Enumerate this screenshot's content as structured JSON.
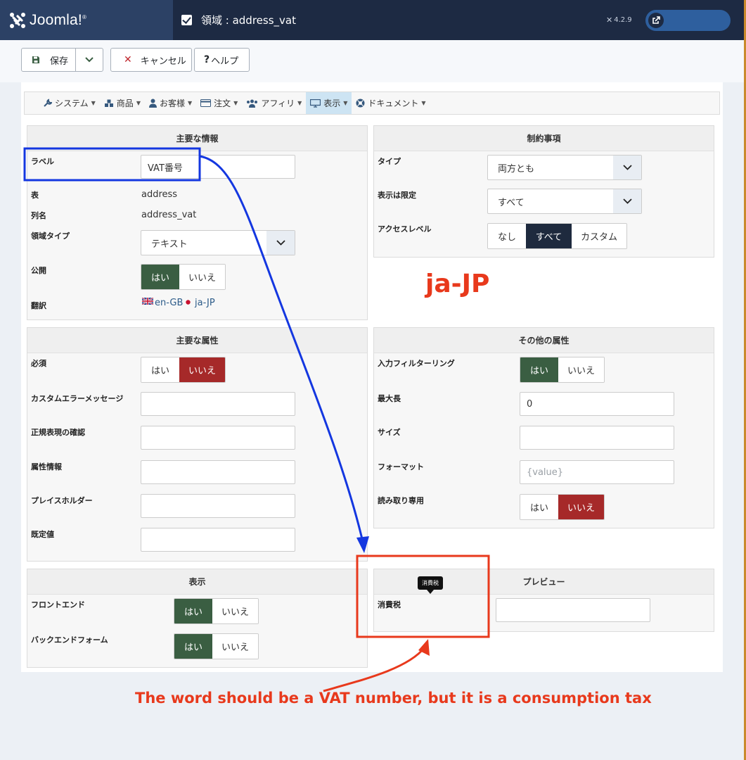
{
  "header": {
    "logo_text": "Joomla!",
    "title": "領域 : address_vat",
    "version": "4.2.9"
  },
  "toolbar": {
    "save_label": "保存",
    "cancel_label": "キャンセル",
    "help_label": "ヘルプ"
  },
  "nav": {
    "items": [
      {
        "label": "システム",
        "icon": "wrench-icon"
      },
      {
        "label": "商品",
        "icon": "cubes-icon"
      },
      {
        "label": "お客様",
        "icon": "user-icon"
      },
      {
        "label": "注文",
        "icon": "credit-card-icon"
      },
      {
        "label": "アフィリ",
        "icon": "users-icon"
      },
      {
        "label": "表示",
        "icon": "desktop-icon",
        "active": true
      },
      {
        "label": "ドキュメント",
        "icon": "support-icon"
      }
    ]
  },
  "main_info": {
    "heading": "主要な情報",
    "label_label": "ラベル",
    "label_value": "VAT番号",
    "table_label": "表",
    "table_value": "address",
    "column_label": "列名",
    "column_value": "address_vat",
    "fieldtype_label": "領域タイプ",
    "fieldtype_value": "テキスト",
    "publish_label": "公開",
    "yes": "はい",
    "no": "いいえ",
    "translate_label": "翻訳",
    "lang_en": "en-GB",
    "lang_ja": "ja-JP"
  },
  "restrictions": {
    "heading": "制約事項",
    "type_label": "タイプ",
    "type_value": "両方とも",
    "display_label": "表示は限定",
    "display_value": "すべて",
    "access_label": "アクセスレベル",
    "access_options": [
      "なし",
      "すべて",
      "カスタム"
    ]
  },
  "main_attrs": {
    "heading": "主要な属性",
    "required_label": "必須",
    "yes": "はい",
    "no": "いいえ",
    "error_label": "カスタムエラーメッセージ",
    "regex_label": "正規表現の確認",
    "attr_label": "属性情報",
    "placeholder_label": "プレイスホルダー",
    "default_label": "既定値"
  },
  "other_attrs": {
    "heading": "その他の属性",
    "filter_label": "入力フィルターリング",
    "yes": "はい",
    "no": "いいえ",
    "maxlength_label": "最大長",
    "maxlength_value": "0",
    "size_label": "サイズ",
    "format_label": "フォーマット",
    "format_placeholder": "{value}",
    "readonly_label": "読み取り専用"
  },
  "display": {
    "heading": "表示",
    "frontend_label": "フロントエンド",
    "backend_label": "バックエンドフォーム",
    "yes": "はい",
    "no": "いいえ"
  },
  "preview": {
    "heading": "プレビュー",
    "field_label": "消費税",
    "tooltip": "消費税"
  },
  "annotations": {
    "locale": "ja-JP",
    "note": "The word should be a VAT number, but it is a consumption tax",
    "blue": "#1437e0",
    "red": "#e8391c"
  },
  "colors": {
    "header_bg": "#1d2a43",
    "logo_bg": "#2c4165",
    "yes_green": "#3a5e42",
    "no_red": "#a62929",
    "selected_dark": "#1e2a3e"
  }
}
